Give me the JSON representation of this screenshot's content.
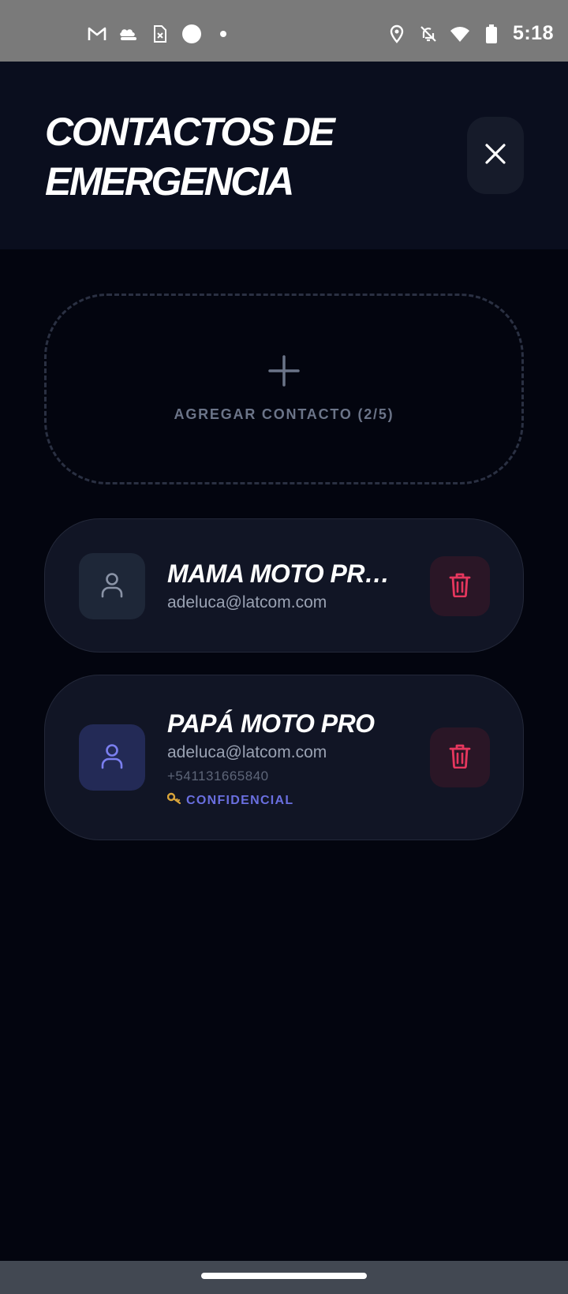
{
  "status_bar": {
    "time": "5:18",
    "left_icons": [
      "gmail-icon",
      "cloud-hand-icon",
      "sim-error-icon",
      "circle-icon",
      "dot-icon"
    ],
    "right_icons": [
      "location-icon",
      "bell-off-icon",
      "wifi-icon",
      "battery-icon"
    ]
  },
  "header": {
    "title": "CONTACTOS DE EMERGENCIA",
    "close_icon": "close-icon"
  },
  "add_contact": {
    "label": "AGREGAR CONTACTO (2/5)",
    "icon": "plus-icon"
  },
  "contacts": [
    {
      "name": "MAMA MOTO PROTECCIÓN",
      "email": "adeluca@latcom.com",
      "phone": "",
      "confidential": false,
      "avatar_color": "#1e2738",
      "icon_color": "#8a93a6"
    },
    {
      "name": "PAPÁ MOTO PRO",
      "email": "adeluca@latcom.com",
      "phone": "+541131665840",
      "confidential": true,
      "confidential_label": "CONFIDENCIAL",
      "avatar_color": "#232a56",
      "icon_color": "#7b7ff0"
    }
  ],
  "colors": {
    "background": "#03050f",
    "header": "#0a0e1e",
    "danger": "#e6375e",
    "accent": "#6a6fe0"
  }
}
